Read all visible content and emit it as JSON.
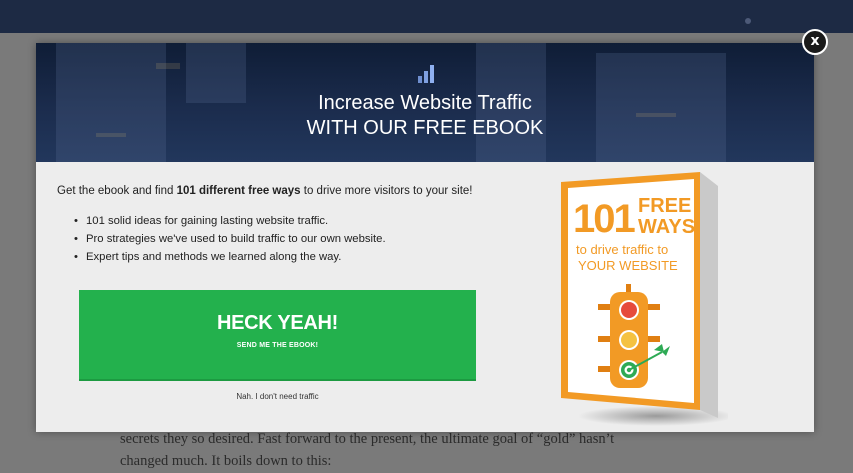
{
  "background": {
    "article_line1": "secrets they so desired. Fast forward to the present, the ultimate goal of “gold” hasn’t",
    "article_line2": "changed much. It boils down to this:"
  },
  "modal": {
    "header": {
      "icon": "bar-chart-icon",
      "title_line1": "Increase Website Traffic",
      "title_line2": "WITH OUR FREE EBOOK"
    },
    "intro_before": "Get the ebook and find ",
    "intro_bold": "101 different free ways",
    "intro_after": " to drive more visitors to your site!",
    "bullets": [
      "101 solid ideas for gaining lasting website traffic.",
      "Pro strategies we've used to build traffic to our own website.",
      "Expert tips and methods we learned along the way."
    ],
    "cta": {
      "main": "HECK YEAH!",
      "sub": "SEND ME THE EBOOK!"
    },
    "decline": "Nah. I don't need traffic",
    "book": {
      "number": "101",
      "word1": "FREE",
      "word2": "WAYS",
      "line1": "to drive traffic to",
      "line2": "YOUR WEBSITE"
    },
    "close_label": "x"
  },
  "colors": {
    "cta_green": "#23b14d",
    "header_navy": "#1b2c4d",
    "book_orange": "#f29a25"
  }
}
